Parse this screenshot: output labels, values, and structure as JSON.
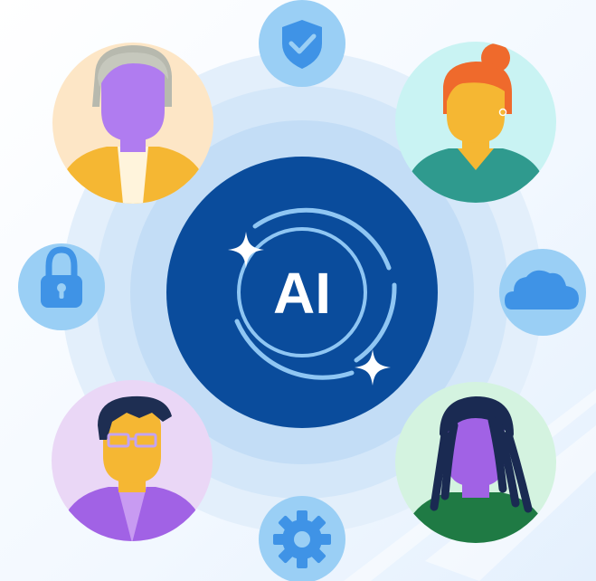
{
  "hub": {
    "label": "AI",
    "icon": "ai-sparkle-icon"
  },
  "colors": {
    "ring_outer": "#dcecfb",
    "ring_inner": "#c6e0f8",
    "hub": "#0a4c9c",
    "hub_ring": "#8fc6f3",
    "badge": "#9acff5",
    "badge_icon": "#3f93e6",
    "sparkle": "#ffffff"
  },
  "people": [
    {
      "id": "older-person",
      "bg": "#fde6c6"
    },
    {
      "id": "woman-redhead",
      "bg": "#c9f3f3"
    },
    {
      "id": "man-glasses",
      "bg": "#ead7f6"
    },
    {
      "id": "person-locs",
      "bg": "#d4f3e0"
    }
  ],
  "badges": [
    {
      "id": "shield-check",
      "icon": "shield-check-icon"
    },
    {
      "id": "padlock",
      "icon": "padlock-icon"
    },
    {
      "id": "cloud",
      "icon": "cloud-icon"
    },
    {
      "id": "gear",
      "icon": "gear-icon"
    }
  ]
}
